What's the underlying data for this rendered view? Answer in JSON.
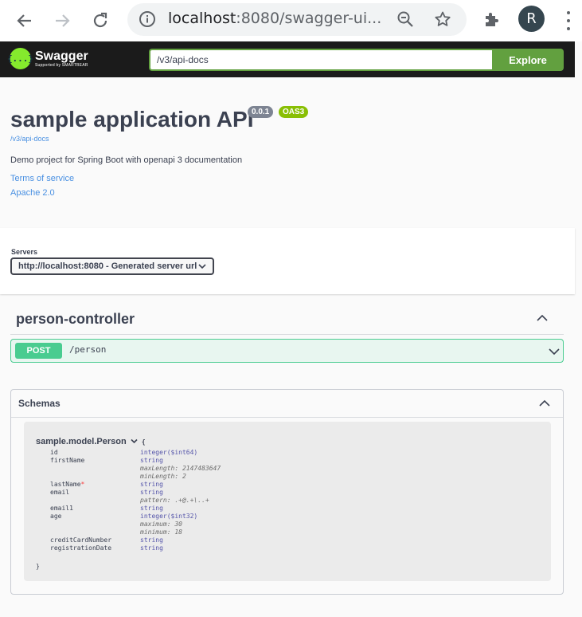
{
  "browser": {
    "url_host": "localhost",
    "url_rest": ":8080/swagger-ui...",
    "profile_initial": "R"
  },
  "topbar": {
    "logo_name": "Swagger",
    "logo_sub": "Supported by SMARTBEAR",
    "logo_mark": "{...}",
    "url_value": "/v3/api-docs",
    "explore_label": "Explore"
  },
  "info": {
    "title": "sample application API",
    "version": "0.0.1",
    "oas": "OAS3",
    "docs_url": "/v3/api-docs",
    "description": "Demo project for Spring Boot with openapi 3 documentation",
    "terms": "Terms of service",
    "license": "Apache 2.0"
  },
  "servers": {
    "label": "Servers",
    "selected": "http://localhost:8080 - Generated server url"
  },
  "tag": {
    "name": "person-controller",
    "operation": {
      "method": "POST",
      "path": "/person"
    }
  },
  "schemas": {
    "title": "Schemas",
    "model_name": "sample.model.Person",
    "open_brace": "{",
    "close_brace": "}",
    "properties": [
      {
        "name": "id",
        "required": "",
        "type": "integer($int64)",
        "extras": []
      },
      {
        "name": "firstName",
        "required": "",
        "type": "string",
        "extras": [
          "maxLength: 2147483647",
          "minLength: 2"
        ]
      },
      {
        "name": "lastName",
        "required": "*",
        "type": "string",
        "extras": []
      },
      {
        "name": "email",
        "required": "",
        "type": "string",
        "extras": [
          "pattern: .+@.+\\..+"
        ]
      },
      {
        "name": "email1",
        "required": "",
        "type": "string",
        "extras": []
      },
      {
        "name": "age",
        "required": "",
        "type": "integer($int32)",
        "extras": [
          "maximum: 30",
          "minimum: 18"
        ]
      },
      {
        "name": "creditCardNumber",
        "required": "",
        "type": "string",
        "extras": []
      },
      {
        "name": "registrationDate",
        "required": "",
        "type": "string",
        "extras": []
      }
    ]
  },
  "colors": {
    "post": "#49cc90",
    "explore": "#62a03f",
    "link": "#4990e2",
    "badge_version": "#7d8492",
    "badge_oas": "#89bf04"
  }
}
